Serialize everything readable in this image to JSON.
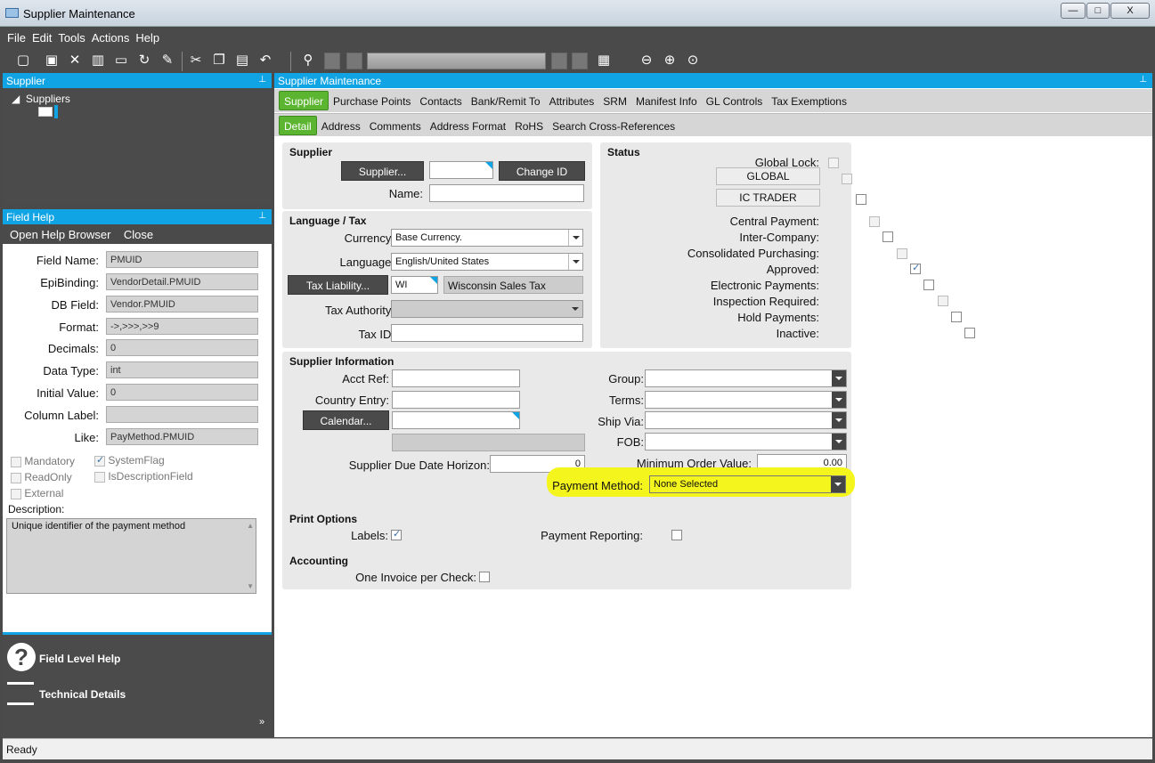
{
  "window": {
    "title": "Supplier Maintenance",
    "min": "—",
    "max": "□",
    "close": "X"
  },
  "menu": [
    "File",
    "Edit",
    "Tools",
    "Actions",
    "Help"
  ],
  "supplier_panel": {
    "title": "Supplier",
    "tree_root": "Suppliers"
  },
  "field_help": {
    "title": "Field Help",
    "open_browser": "Open Help Browser",
    "close": "Close",
    "fields": [
      {
        "label": "Field Name:",
        "value": "PMUID"
      },
      {
        "label": "EpiBinding:",
        "value": "VendorDetail.PMUID"
      },
      {
        "label": "DB Field:",
        "value": "Vendor.PMUID"
      },
      {
        "label": "Format:",
        "value": "->,>>>,>>9"
      },
      {
        "label": "Decimals:",
        "value": "0"
      },
      {
        "label": "Data Type:",
        "value": "int"
      },
      {
        "label": "Initial Value:",
        "value": "0"
      },
      {
        "label": "Column Label:",
        "value": ""
      },
      {
        "label": "Like:",
        "value": "PayMethod.PMUID"
      }
    ],
    "flags": {
      "mandatory": "Mandatory",
      "systemflag": "SystemFlag",
      "readonly": "ReadOnly",
      "isdesc": "IsDescriptionField",
      "external": "External"
    },
    "description_label": "Description:",
    "description": "Unique identifier of the payment method"
  },
  "links": {
    "field_level_help": "Field Level Help",
    "technical_details": "Technical Details"
  },
  "main": {
    "title": "Supplier Maintenance",
    "tabs": [
      "Supplier",
      "Purchase Points",
      "Contacts",
      "Bank/Remit To",
      "Attributes",
      "SRM",
      "Manifest Info",
      "GL Controls",
      "Tax Exemptions"
    ],
    "subtabs": [
      "Detail",
      "Address",
      "Comments",
      "Address Format",
      "RoHS",
      "Search Cross-References"
    ],
    "supplier_sec": {
      "title": "Supplier",
      "supplier_btn": "Supplier...",
      "change_id": "Change ID",
      "name_label": "Name:"
    },
    "lang_sec": {
      "title": "Language / Tax",
      "currency_label": "Currency:",
      "currency": "Base Currency.",
      "language_label": "Language:",
      "language": "English/United States",
      "tax_liability_btn": "Tax Liability...",
      "tax_code": "WI",
      "tax_desc": "Wisconsin Sales Tax",
      "tax_authority_label": "Tax Authority:",
      "tax_id_label": "Tax ID:"
    },
    "status_sec": {
      "title": "Status",
      "global_lock": "Global Lock:",
      "global_btn": "GLOBAL",
      "ic_trader_btn": "IC TRADER",
      "central_payment": "Central Payment:",
      "inter_company": "Inter-Company:",
      "consolidated": "Consolidated Purchasing:",
      "approved": "Approved:",
      "electronic": "Electronic Payments:",
      "inspection": "Inspection Required:",
      "hold": "Hold Payments:",
      "inactive": "Inactive:"
    },
    "info_sec": {
      "title": "Supplier Information",
      "acct_ref": "Acct Ref:",
      "country_entry": "Country Entry:",
      "calendar_btn": "Calendar...",
      "due_date_horizon": "Supplier Due Date Horizon:",
      "due_date_value": "0",
      "group": "Group:",
      "terms": "Terms:",
      "ship_via": "Ship Via:",
      "fob": "FOB:",
      "min_order": "Minimum Order Value:",
      "min_order_value": "0.00",
      "payment_method": "Payment Method:",
      "payment_method_value": "None Selected"
    },
    "print_sec": {
      "title": "Print Options",
      "labels": "Labels:",
      "payment_reporting": "Payment Reporting:"
    },
    "acct_sec": {
      "title": "Accounting",
      "one_invoice": "One Invoice per Check:"
    }
  },
  "status": "Ready",
  "colors": {
    "accent": "#11a4e4",
    "tab_active": "#5cb531",
    "highlight": "#f5f51e"
  }
}
